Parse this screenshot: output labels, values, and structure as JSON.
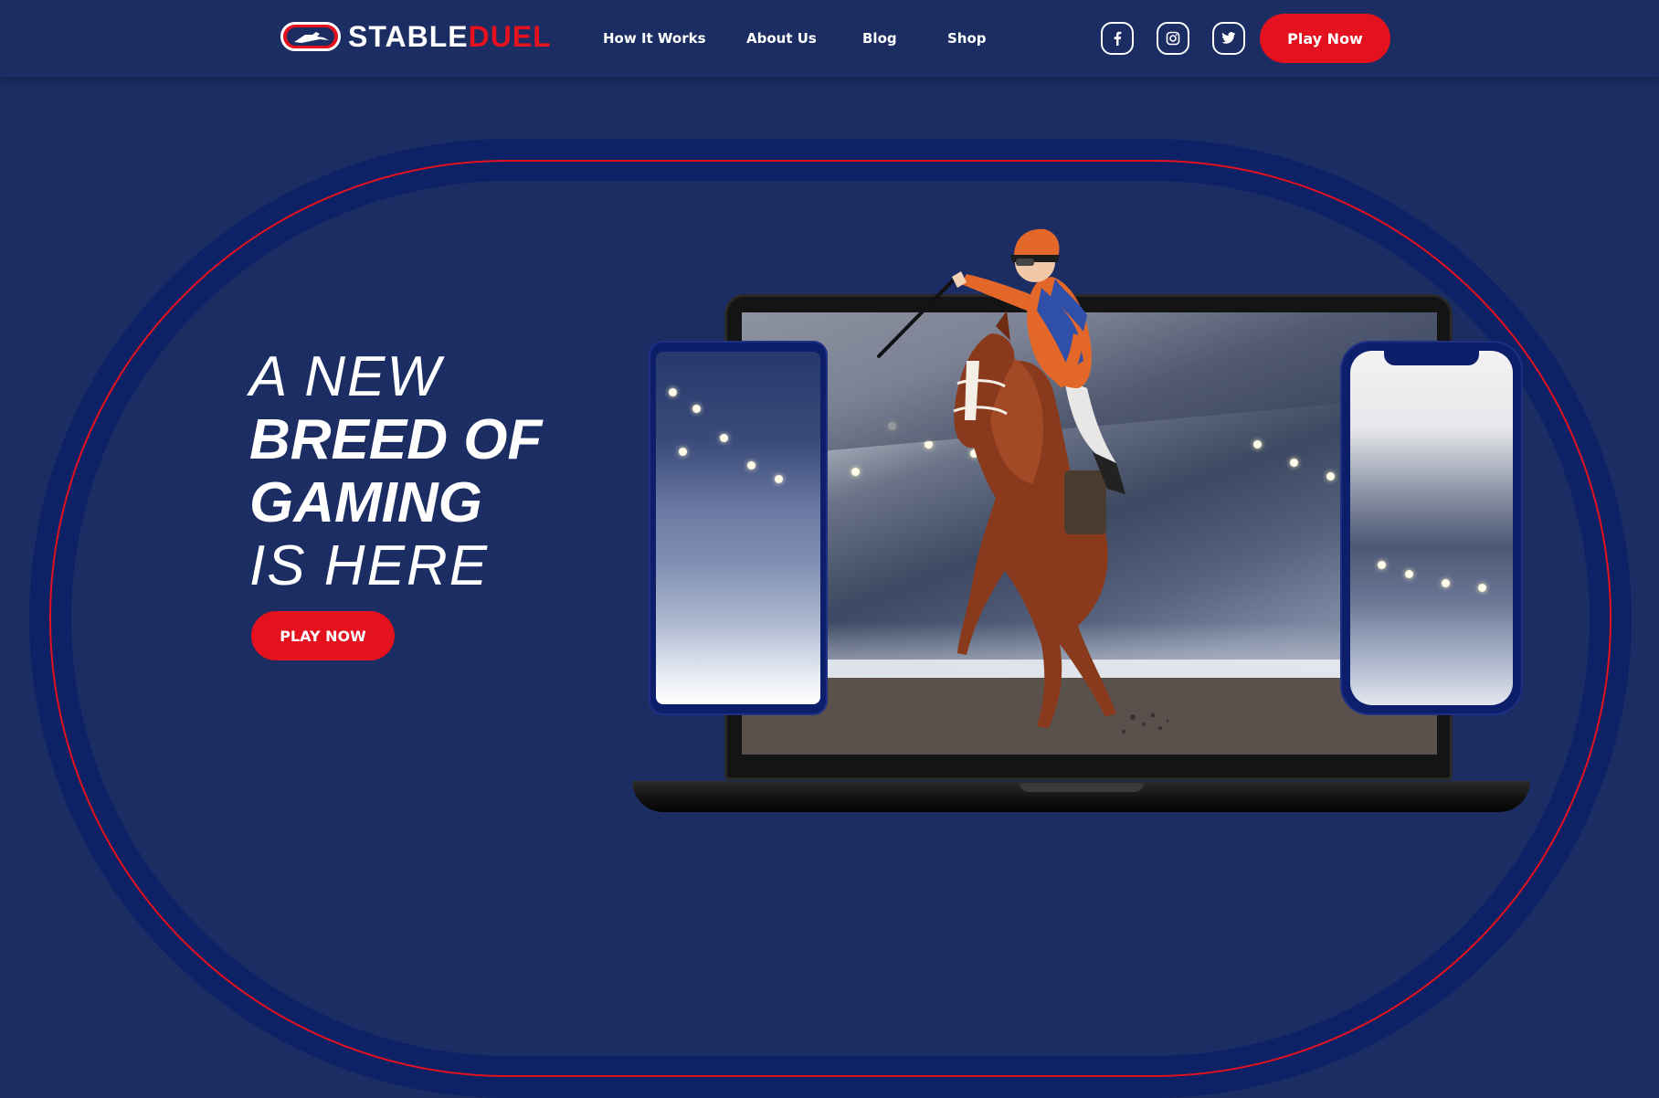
{
  "brand": {
    "logo_part1": "STABLE",
    "logo_part2": "DUEL"
  },
  "nav": {
    "items": [
      "How It Works",
      "About Us",
      "Blog",
      "Shop"
    ]
  },
  "social": [
    "facebook-icon",
    "instagram-icon",
    "twitter-icon"
  ],
  "header": {
    "play_label": "Play Now"
  },
  "hero": {
    "line1": "A NEW",
    "line2": "BREED OF",
    "line3": "GAMING",
    "line4": "IS HERE",
    "cta_label": "PLAY NOW"
  },
  "colors": {
    "background": "#1b2d63",
    "accent": "#e3121e",
    "track": "#0d2166"
  }
}
